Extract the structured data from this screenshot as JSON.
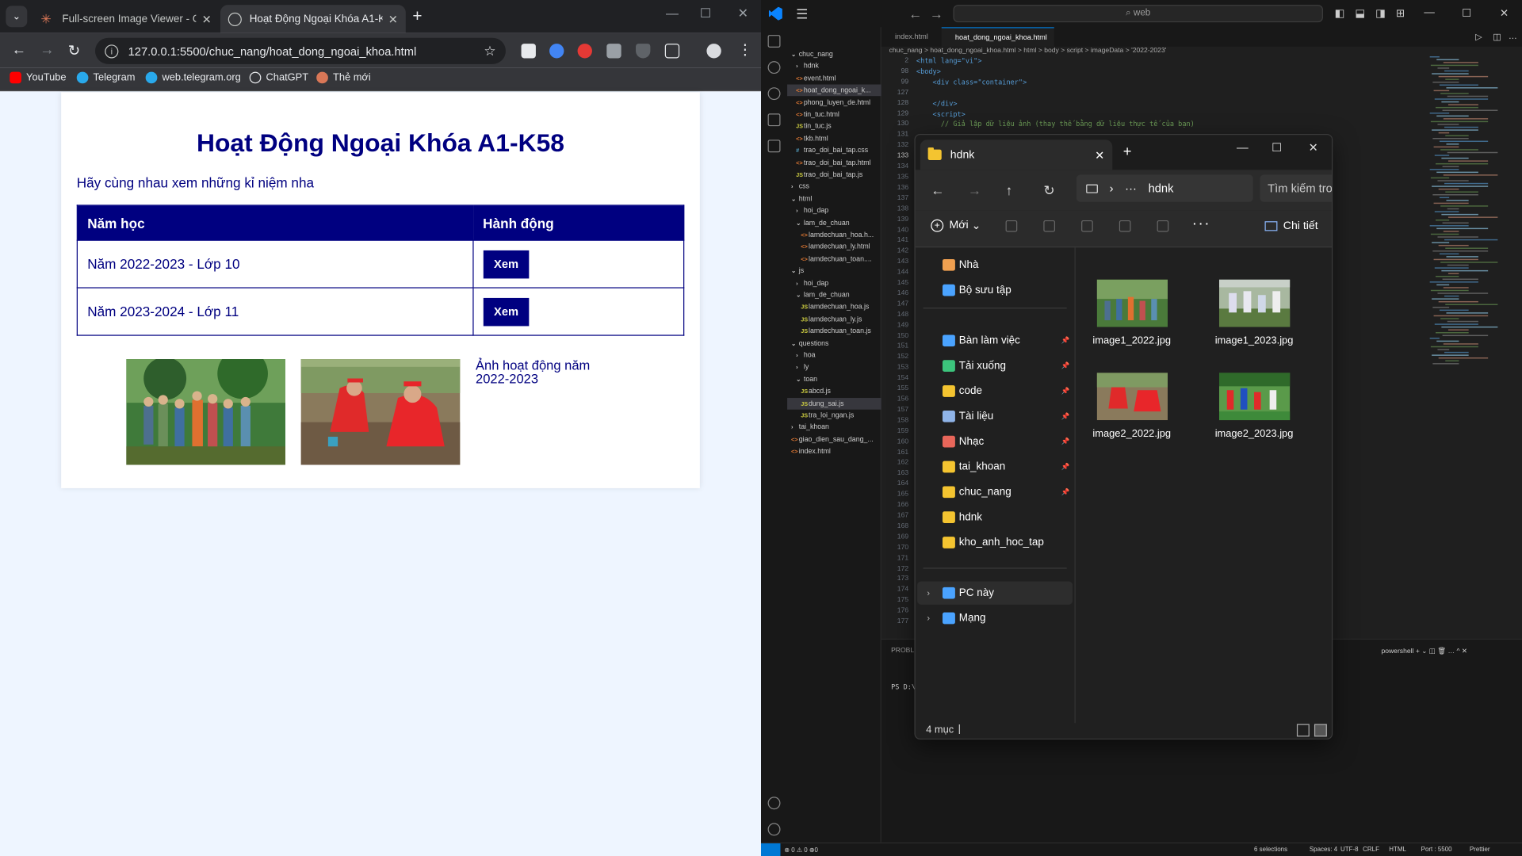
{
  "chrome": {
    "tabs": [
      {
        "title": "Full-screen Image Viewer - Clau",
        "active": false
      },
      {
        "title": "Hoạt Động Ngoại Khóa A1-K58",
        "active": true
      }
    ],
    "url": "127.0.0.1:5500/chuc_nang/hoat_dong_ngoai_khoa.html",
    "bookmarks": [
      "YouTube",
      "Telegram",
      "web.telegram.org",
      "ChatGPT",
      "Thẻ mới"
    ]
  },
  "page": {
    "title": "Hoạt Động Ngoại Khóa A1-K58",
    "intro": "Hãy cùng nhau xem những kỉ niệm nha",
    "table": {
      "headers": [
        "Năm học",
        "Hành động"
      ],
      "rows": [
        {
          "year": "Năm 2022-2023 - Lớp 10",
          "action": "Xem"
        },
        {
          "year": "Năm 2023-2024 - Lớp 11",
          "action": "Xem"
        }
      ]
    },
    "broken_image_alt": "Ảnh hoạt động năm 2022-2023"
  },
  "vscode": {
    "search": "web",
    "tabs": [
      "index.html",
      "hoat_dong_ngoai_khoa.html"
    ],
    "breadcrumb": "chuc_nang > hoat_dong_ngoai_khoa.html > html > body > script > imageData > '2022-2023'",
    "explorer": [
      {
        "label": "chuc_nang",
        "kind": "folder-open",
        "depth": 0
      },
      {
        "label": "hdnk",
        "kind": "folder",
        "depth": 1
      },
      {
        "label": "event.html",
        "kind": "html",
        "depth": 1
      },
      {
        "label": "hoat_dong_ngoai_k...",
        "kind": "html",
        "depth": 1,
        "selected": true
      },
      {
        "label": "phong_luyen_de.html",
        "kind": "html",
        "depth": 1
      },
      {
        "label": "tin_tuc.html",
        "kind": "html",
        "depth": 1
      },
      {
        "label": "tin_tuc.js",
        "kind": "js",
        "depth": 1
      },
      {
        "label": "tkb.html",
        "kind": "html",
        "depth": 1
      },
      {
        "label": "trao_doi_bai_tap.css",
        "kind": "css",
        "depth": 1
      },
      {
        "label": "trao_doi_bai_tap.html",
        "kind": "html",
        "depth": 1
      },
      {
        "label": "trao_doi_bai_tap.js",
        "kind": "js",
        "depth": 1
      },
      {
        "label": "css",
        "kind": "folder",
        "depth": 0
      },
      {
        "label": "html",
        "kind": "folder-open",
        "depth": 0
      },
      {
        "label": "hoi_dap",
        "kind": "folder",
        "depth": 1
      },
      {
        "label": "lam_de_chuan",
        "kind": "folder-open",
        "depth": 1
      },
      {
        "label": "lamdechuan_hoa.h...",
        "kind": "html",
        "depth": 2
      },
      {
        "label": "lamdechuan_ly.html",
        "kind": "html",
        "depth": 2
      },
      {
        "label": "lamdechuan_toan....",
        "kind": "html",
        "depth": 2
      },
      {
        "label": "js",
        "kind": "folder-open",
        "depth": 0
      },
      {
        "label": "hoi_dap",
        "kind": "folder",
        "depth": 1
      },
      {
        "label": "lam_de_chuan",
        "kind": "folder-open",
        "depth": 1
      },
      {
        "label": "lamdechuan_hoa.js",
        "kind": "js",
        "depth": 2
      },
      {
        "label": "lamdechuan_ly.js",
        "kind": "js",
        "depth": 2
      },
      {
        "label": "lamdechuan_toan.js",
        "kind": "js",
        "depth": 2
      },
      {
        "label": "questions",
        "kind": "folder-open",
        "depth": 0
      },
      {
        "label": "hoa",
        "kind": "folder",
        "depth": 1
      },
      {
        "label": "ly",
        "kind": "folder",
        "depth": 1
      },
      {
        "label": "toan",
        "kind": "folder-open",
        "depth": 1
      },
      {
        "label": "abcd.js",
        "kind": "js",
        "depth": 2
      },
      {
        "label": "dung_sai.js",
        "kind": "js",
        "depth": 2,
        "selected": true
      },
      {
        "label": "tra_loi_ngan.js",
        "kind": "js",
        "depth": 2
      },
      {
        "label": "tai_khoan",
        "kind": "folder",
        "depth": 0
      },
      {
        "label": "giao_dien_sau_dang_...",
        "kind": "html",
        "depth": 0
      },
      {
        "label": "index.html",
        "kind": "html",
        "depth": 0
      }
    ],
    "line_numbers": [
      "2",
      "98",
      "99",
      "127",
      "128",
      "129",
      "130",
      "131",
      "132",
      "133",
      "134",
      "135",
      "136",
      "137",
      "138",
      "139",
      "140",
      "141",
      "142",
      "143",
      "144",
      "145",
      "146",
      "147",
      "148",
      "149",
      "150",
      "151",
      "152",
      "153",
      "154",
      "155",
      "156",
      "157",
      "158",
      "159",
      "160",
      "161",
      "162",
      "163",
      "164",
      "165",
      "166",
      "167",
      "168",
      "169",
      "170",
      "171",
      "172",
      "173",
      "174",
      "175",
      "176",
      "177"
    ],
    "code_lines": [
      "<html lang=\"vi\">",
      "<body>",
      "    <div class=\"container\">",
      "    </div>",
      "",
      "    <script>",
      "      // Giả lập dữ liệu ảnh (thay thế bằng dữ liệu thực tế của bạn)"
    ],
    "panel": {
      "tab": "PROBLEMS",
      "prompt": "PS D:\\",
      "terminal": "powershell"
    },
    "status": [
      "6 selections",
      "Spaces: 4",
      "UTF-8",
      "CRLF",
      "HTML",
      "Port : 5500",
      "Prettier"
    ],
    "status_left": "⊗ 0 ⚠ 0   ⊕0"
  },
  "file_explorer": {
    "tab_title": "hdnk",
    "address": "hdnk",
    "search_placeholder": "Tìm kiếm trong",
    "new_label": "Mới",
    "details_label": "Chi tiết",
    "nav": [
      {
        "label": "Nhà",
        "icon": "home-icon"
      },
      {
        "label": "Bộ sưu tập",
        "icon": "gallery-icon"
      },
      {
        "label": "Bàn làm việc",
        "icon": "desktop-icon",
        "pinned": true
      },
      {
        "label": "Tải xuống",
        "icon": "download-icon",
        "pinned": true
      },
      {
        "label": "code",
        "icon": "folder-icon",
        "pinned": true
      },
      {
        "label": "Tài liệu",
        "icon": "documents-icon",
        "pinned": true
      },
      {
        "label": "Nhạc",
        "icon": "music-icon",
        "pinned": true
      },
      {
        "label": "tai_khoan",
        "icon": "folder-icon",
        "pinned": true
      },
      {
        "label": "chuc_nang",
        "icon": "folder-icon",
        "pinned": true
      },
      {
        "label": "hdnk",
        "icon": "folder-icon"
      },
      {
        "label": "kho_anh_hoc_tap",
        "icon": "folder-icon"
      },
      {
        "label": "PC này",
        "icon": "pc-icon"
      },
      {
        "label": "Mạng",
        "icon": "network-icon"
      }
    ],
    "files": [
      "image1_2022.jpg",
      "image1_2023.jpg",
      "image2_2022.jpg",
      "image2_2023.jpg"
    ],
    "count": "4 mục"
  }
}
